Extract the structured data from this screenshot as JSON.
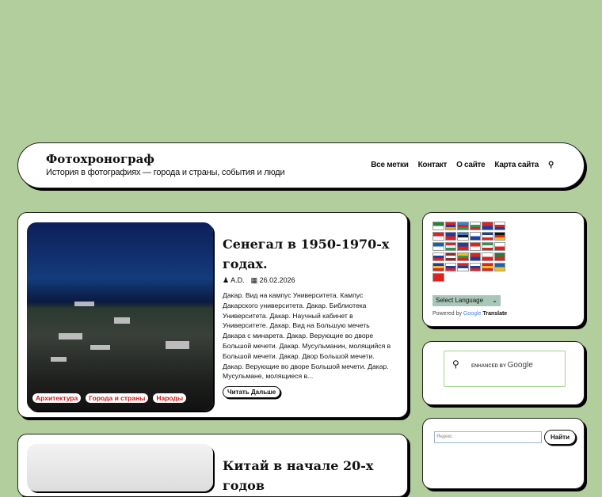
{
  "header": {
    "title": "Фотохронограф",
    "description": "История в фотографиях — города и страны, события и люди",
    "nav": [
      "Все метки",
      "Контакт",
      "О сайте",
      "Карта сайта"
    ],
    "search_icon": "search-icon"
  },
  "posts": [
    {
      "title": "Сенегал в 1950-1970-х годах.",
      "author": "A.D.",
      "date": "26.02.2026",
      "excerpt": "Дакар. Вид на кампус Университета. Кампус Дакарского университета. Дакар. Библиотека Университета. Дакар. Научный кабинет в Университете. Дакар. Вид на Большую мечеть Дакара с минарета. Дакар. Верующие во дворе Большой мечети. Дакар. Мусульманин, молящийся в Большой мечети. Дакар. Двор Большой мечети. Дакар. Верующие во дворе Большой мечети. Дакар. Мусульмане, молящиеся в...",
      "tags": [
        "Архитектура",
        "Города и страны",
        "Народы"
      ],
      "more": "Читать Дальше"
    },
    {
      "title": "Китай в начале 20-х годов"
    }
  ],
  "translate": {
    "flags": [
      [
        "#2e7d32",
        "#fff"
      ],
      [
        "#d22",
        "#1a3fa0",
        "#f0a020"
      ],
      [
        "#2a8bd0",
        "#d22",
        "#2a9a4a"
      ],
      [
        "#fff",
        "#2a9a4a",
        "#d22"
      ],
      [
        "#d22",
        "#1a3fa0"
      ],
      [
        "#fff",
        "#d22",
        "#1a3fa0"
      ],
      [
        "#d22",
        "#fff"
      ],
      [
        "#1a3fa0",
        "#d22"
      ],
      [
        "#3a7ad0",
        "#111",
        "#fff"
      ],
      [
        "#fff",
        "#1a3fa0"
      ],
      [
        "#1a3fa0",
        "#fff",
        "#d22"
      ],
      [
        "#111",
        "#d22",
        "#f0c020"
      ],
      [
        "#1a5fb0",
        "#fff"
      ],
      [
        "#d22",
        "#fff",
        "#2a9a4a"
      ],
      [
        "#1a3fa0",
        "#d22"
      ],
      [
        "#d22",
        "#fff"
      ],
      [
        "#2a9a4a",
        "#fff",
        "#d22"
      ],
      [
        "#fff",
        "#d22"
      ],
      [
        "#fff",
        "#1a3fa0",
        "#d22"
      ],
      [
        "#8a2a2a",
        "#fff",
        "#8a2a2a"
      ],
      [
        "#f0c020",
        "#2a9a4a",
        "#d22"
      ],
      [
        "#d22",
        "#1a3fa0"
      ],
      [
        "#fff",
        "#d22"
      ],
      [
        "#2a7a3a",
        "#d22"
      ],
      [
        "#1a3fa0",
        "#f0c020",
        "#d22"
      ],
      [
        "#fff",
        "#1a3fa0",
        "#d22"
      ],
      [
        "#d22",
        "#1a3fa0",
        "#fff"
      ],
      [
        "#fff",
        "#1a3fa0",
        "#d22"
      ],
      [
        "#d22",
        "#f0c020",
        "#d22"
      ],
      [
        "#1a5fb0",
        "#f0c020"
      ],
      [
        "#d22",
        "#d22"
      ]
    ],
    "select_label": "Select Language",
    "powered_by": "Powered by",
    "google": "Google",
    "translate": "Translate"
  },
  "gcse": {
    "enhanced": "ENHANCED BY",
    "google": "Google"
  },
  "yandex": {
    "placeholder": "Яндекс",
    "button": "Найти"
  }
}
